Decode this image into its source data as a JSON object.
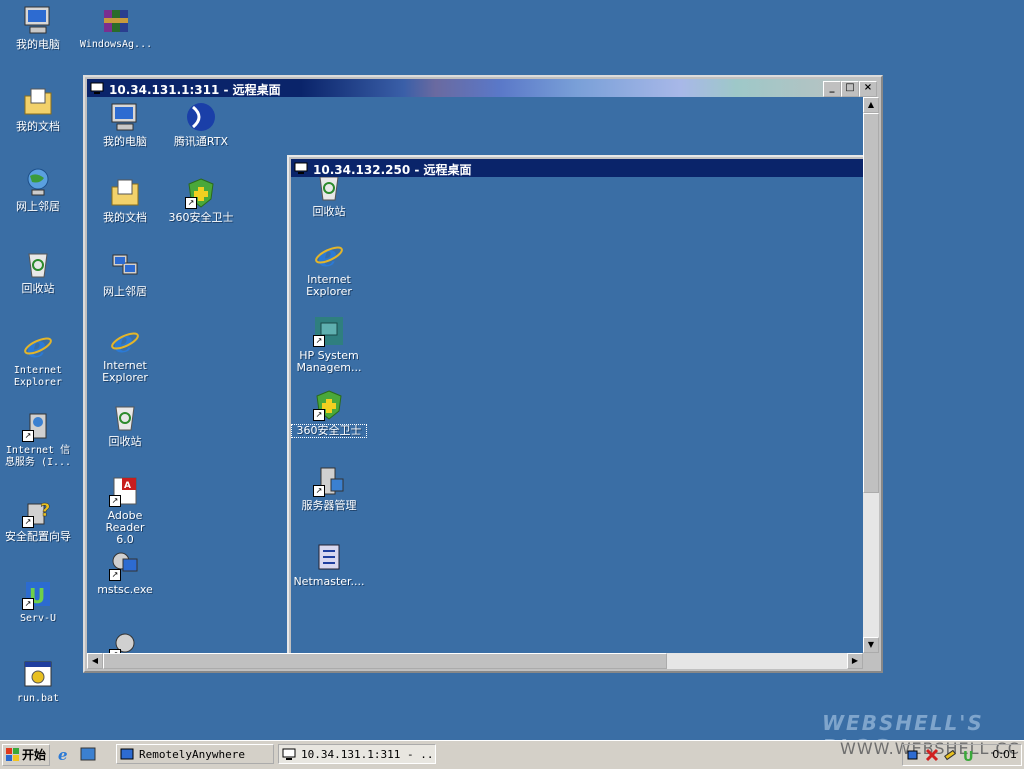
{
  "desktop_icons": [
    {
      "label": "我的电脑",
      "icon": "my-computer-icon"
    },
    {
      "label": "WindowsAg...",
      "icon": "winrar-archive-icon"
    },
    {
      "label": "我的文档",
      "icon": "my-documents-icon"
    },
    {
      "label": "网上邻居",
      "icon": "network-neighborhood-icon"
    },
    {
      "label": "回收站",
      "icon": "recycle-bin-icon"
    },
    {
      "label": "Internet\nExplorer",
      "icon": "internet-explorer-icon"
    },
    {
      "label": "Internet 信\n息服务 (I...",
      "icon": "iis-icon"
    },
    {
      "label": "安全配置向导",
      "icon": "security-wizard-icon"
    },
    {
      "label": "Serv-U",
      "icon": "serv-u-icon"
    },
    {
      "label": "run.bat",
      "icon": "batch-file-icon"
    }
  ],
  "outer_window": {
    "title": "10.34.131.1:311 - 远程桌面",
    "icons": [
      {
        "label": "我的电脑",
        "icon": "my-computer-icon"
      },
      {
        "label": "腾讯通RTX",
        "icon": "rtx-icon"
      },
      {
        "label": "我的文档",
        "icon": "my-documents-icon"
      },
      {
        "label": "360安全卫士",
        "icon": "360-safe-icon"
      },
      {
        "label": "网上邻居",
        "icon": "network-neighborhood-icon"
      },
      {
        "label": "Internet\nExplorer",
        "icon": "internet-explorer-icon"
      },
      {
        "label": "回收站",
        "icon": "recycle-bin-icon"
      },
      {
        "label": "Adobe Reader\n6.0",
        "icon": "adobe-reader-icon"
      },
      {
        "label": "mstsc.exe",
        "icon": "mstsc-icon"
      }
    ]
  },
  "inner_window": {
    "title": "10.34.132.250 - 远程桌面",
    "icons": [
      {
        "label": "回收站",
        "icon": "recycle-bin-icon"
      },
      {
        "label": "Internet\nExplorer",
        "icon": "internet-explorer-icon"
      },
      {
        "label": "HP System\nManagem...",
        "icon": "hp-system-management-icon"
      },
      {
        "label": "360安全卫士",
        "icon": "360-safe-icon"
      },
      {
        "label": "服务器管理",
        "icon": "server-manager-icon"
      },
      {
        "label": "Netmaster....",
        "icon": "netmaster-icon"
      }
    ]
  },
  "taskbar": {
    "start_label": "开始",
    "tasks": [
      {
        "label": "RemotelyAnywhere"
      },
      {
        "label": "10.34.131.1:311 - ..."
      }
    ],
    "clock": "0:01"
  },
  "watermark": {
    "line1": "WEBSHELL'S BLOG",
    "line2": "WWW.WEBSHELL.CC"
  }
}
